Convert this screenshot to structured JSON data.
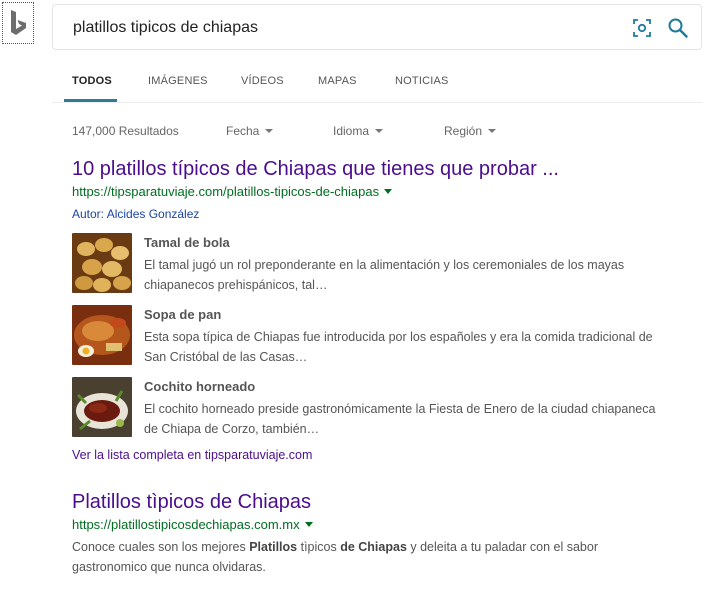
{
  "search": {
    "query": "platillos tipicos de chiapas"
  },
  "tabs": [
    {
      "label": "TODOS",
      "active": true
    },
    {
      "label": "IMÁGENES",
      "active": false
    },
    {
      "label": "VÍDEOS",
      "active": false
    },
    {
      "label": "MAPAS",
      "active": false
    },
    {
      "label": "NOTICIAS",
      "active": false
    }
  ],
  "filters": {
    "count": "147,000 Resultados",
    "date": "Fecha",
    "language": "Idioma",
    "region": "Región"
  },
  "results": [
    {
      "title": "10 platillos típicos de Chiapas que tienes que probar ...",
      "url": "https://tipsparatuviaje.com/platillos-tipicos-de-chiapas",
      "author_label": "Autor:",
      "author": "Alcides González",
      "items": [
        {
          "title": "Tamal de bola",
          "line1": "El tamal jugó un rol preponderante en la alimentación y los ceremoniales de los mayas",
          "line2": "chiapanecos prehispánicos, tal…"
        },
        {
          "title": "Sopa de pan",
          "line1": "Esta sopa típica de Chiapas fue introducida por los españoles y era la comida tradicional de",
          "line2": "San Cristóbal de las Casas…"
        },
        {
          "title": "Cochito horneado",
          "line1": "El cochito horneado preside gastronómicamente la Fiesta de Enero de la ciudad chiapaneca",
          "line2": "de Chiapa de Corzo, también…"
        }
      ],
      "more_link": "Ver la lista completa en tipsparatuviaje.com"
    },
    {
      "title": "Platillos tìpicos de Chiapas",
      "url": "https://platillostipicosdechiapas.com.mx",
      "snippet": {
        "part1": "Conoce cuales son los mejores ",
        "bold1": "Platillos",
        "part2": " tìpicos ",
        "bold2": "de Chiapas",
        "part3": " y deleita a tu paladar con el sabor",
        "line2": "gastronomico que nunca olvidaras."
      }
    }
  ],
  "colors": {
    "accent": "#2f7d95",
    "title_link": "#4b0d8e",
    "url_green": "#006d21",
    "author_blue": "#1a44a6"
  },
  "icons": {
    "logo": "bing-logo",
    "visual_search": "visual-search-icon",
    "search": "search-icon"
  }
}
